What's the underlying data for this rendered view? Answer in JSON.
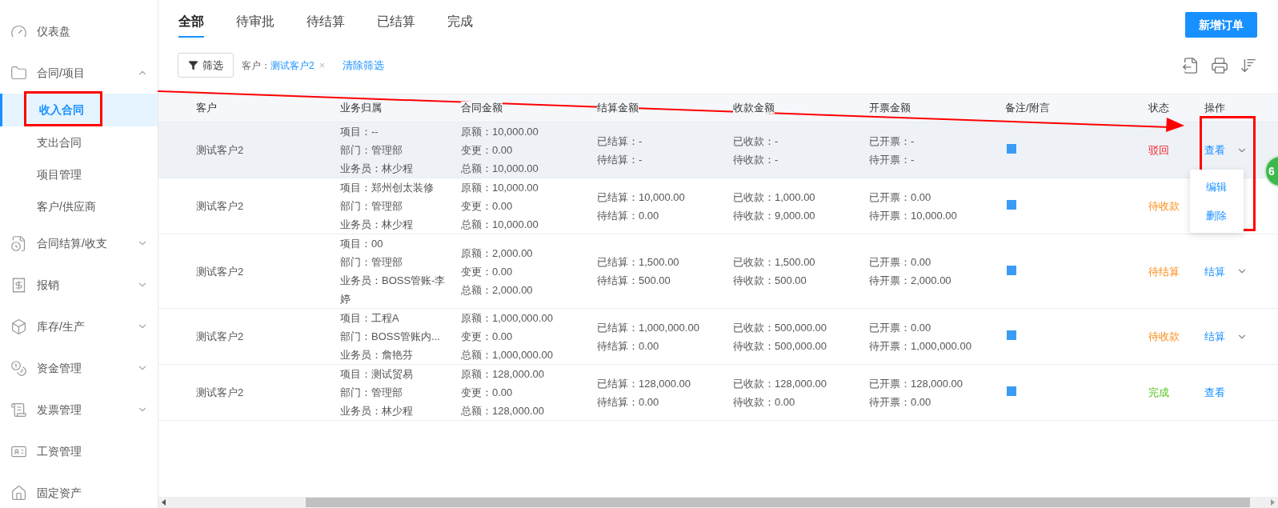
{
  "sidebar": {
    "items": [
      {
        "label": "仪表盘"
      },
      {
        "label": "合同/项目",
        "expanded": true,
        "children": [
          {
            "label": "收入合同",
            "selected": true
          },
          {
            "label": "支出合同",
            "selected": false
          },
          {
            "label": "项目管理",
            "selected": false
          },
          {
            "label": "客户/供应商",
            "selected": false
          }
        ]
      },
      {
        "label": "合同结算/收支",
        "expanded": false
      },
      {
        "label": "报销",
        "expanded": false
      },
      {
        "label": "库存/生产",
        "expanded": false
      },
      {
        "label": "资金管理",
        "expanded": false
      },
      {
        "label": "发票管理",
        "expanded": false
      },
      {
        "label": "工资管理"
      },
      {
        "label": "固定资产"
      }
    ]
  },
  "tabs": [
    {
      "label": "全部",
      "selected": true
    },
    {
      "label": "待审批",
      "selected": false
    },
    {
      "label": "待结算",
      "selected": false
    },
    {
      "label": "已结算",
      "selected": false
    },
    {
      "label": "完成",
      "selected": false
    }
  ],
  "new_button": "新增订单",
  "filter": {
    "button": "筛选",
    "tag_key": "客户：",
    "tag_value": "测试客户2",
    "tag_close": "×",
    "clear": "清除筛选"
  },
  "table": {
    "columns": [
      "客户",
      "业务归属",
      "合同金额",
      "结算金额",
      "收款金额",
      "开票金额",
      "备注/附言",
      "状态",
      "操作"
    ],
    "rows": [
      {
        "highlighted": true,
        "customer": "测试客户2",
        "business": [
          "项目：--",
          "部门：管理部",
          "业务员：林少程"
        ],
        "amount": [
          "原额：10,000.00",
          "变更：0.00",
          "总额：10,000.00"
        ],
        "settle": [
          "已结算：-",
          "待结算：-"
        ],
        "received": [
          "已收款：-",
          "待收款：-"
        ],
        "invoice": [
          "已开票：-",
          "待开票：-"
        ],
        "status": {
          "text": "驳回",
          "kind": "rejected"
        },
        "action": {
          "label": "查看",
          "has_menu": true,
          "menu": [
            "编辑",
            "删除"
          ]
        }
      },
      {
        "highlighted": false,
        "customer": "测试客户2",
        "business": [
          "项目：郑州创太装修",
          "部门：管理部",
          "业务员：林少程"
        ],
        "amount": [
          "原额：10,000.00",
          "变更：0.00",
          "总额：10,000.00"
        ],
        "settle": [
          "已结算：10,000.00",
          "待结算：0.00"
        ],
        "received": [
          "已收款：1,000.00",
          "待收款：9,000.00"
        ],
        "invoice": [
          "已开票：0.00",
          "待开票：10,000.00"
        ],
        "status": {
          "text": "待收款",
          "kind": "pending"
        }
      },
      {
        "highlighted": false,
        "customer": "测试客户2",
        "business": [
          "项目：00",
          "部门：管理部",
          "业务员：BOSS管账-李婷"
        ],
        "amount": [
          "原额：2,000.00",
          "变更：0.00",
          "总额：2,000.00"
        ],
        "settle": [
          "已结算：1,500.00",
          "待结算：500.00"
        ],
        "received": [
          "已收款：1,500.00",
          "待收款：500.00"
        ],
        "invoice": [
          "已开票：0.00",
          "待开票：2,000.00"
        ],
        "status": {
          "text": "待结算",
          "kind": "pending"
        },
        "action": {
          "label": "结算",
          "has_menu": true
        }
      },
      {
        "highlighted": false,
        "customer": "测试客户2",
        "business": [
          "项目：工程A",
          "部门：BOSS管账内...",
          "业务员：詹艳芬"
        ],
        "amount": [
          "原额：1,000,000.00",
          "变更：0.00",
          "总额：1,000,000.00"
        ],
        "settle": [
          "已结算：1,000,000.00",
          "待结算：0.00"
        ],
        "received": [
          "已收款：500,000.00",
          "待收款：500,000.00"
        ],
        "invoice": [
          "已开票：0.00",
          "待开票：1,000,000.00"
        ],
        "status": {
          "text": "待收款",
          "kind": "pending"
        },
        "action": {
          "label": "结算",
          "has_menu": true
        }
      },
      {
        "highlighted": false,
        "customer": "测试客户2",
        "business": [
          "项目：测试贸易",
          "部门：管理部",
          "业务员：林少程"
        ],
        "amount": [
          "原额：128,000.00",
          "变更：0.00",
          "总额：128,000.00"
        ],
        "settle": [
          "已结算：128,000.00",
          "待结算：0.00"
        ],
        "received": [
          "已收款：128,000.00",
          "待收款：0.00"
        ],
        "invoice": [
          "已开票：128,000.00",
          "待开票：0.00"
        ],
        "status": {
          "text": "完成",
          "kind": "done"
        },
        "action": {
          "label": "查看",
          "has_menu": false
        }
      }
    ]
  },
  "floating_badge": "6"
}
